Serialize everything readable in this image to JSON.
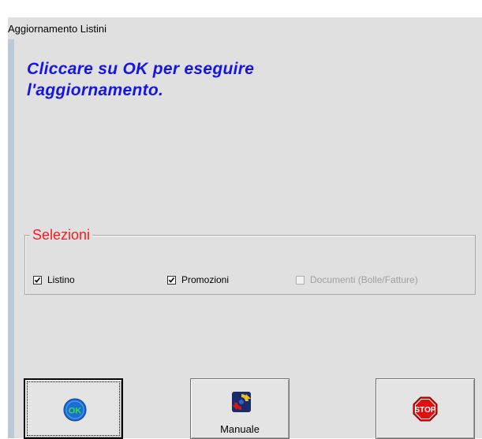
{
  "window": {
    "title": "Aggiornamento Listini"
  },
  "message": {
    "line1": "Cliccare su OK per eseguire",
    "line2": "l'aggiornamento."
  },
  "selections": {
    "title": "Selezioni",
    "items": [
      {
        "label": "Listino",
        "checked": true,
        "enabled": true
      },
      {
        "label": "Promozioni",
        "checked": true,
        "enabled": true
      },
      {
        "label": "Documenti (Bolle/Fatture)",
        "checked": false,
        "enabled": false
      }
    ]
  },
  "buttons": {
    "ok": {
      "icon": "ok-icon",
      "icon_text": "OK"
    },
    "manual": {
      "label": "Manuale",
      "icon": "refresh-icon"
    },
    "stop": {
      "icon": "stop-icon",
      "icon_text": "STOP"
    }
  },
  "colors": {
    "message": "#1515e8",
    "group_title": "#ff1a1a",
    "ok_circle": "#1a6fd6",
    "ok_text": "#3ddc3d",
    "stop": "#e01010"
  }
}
